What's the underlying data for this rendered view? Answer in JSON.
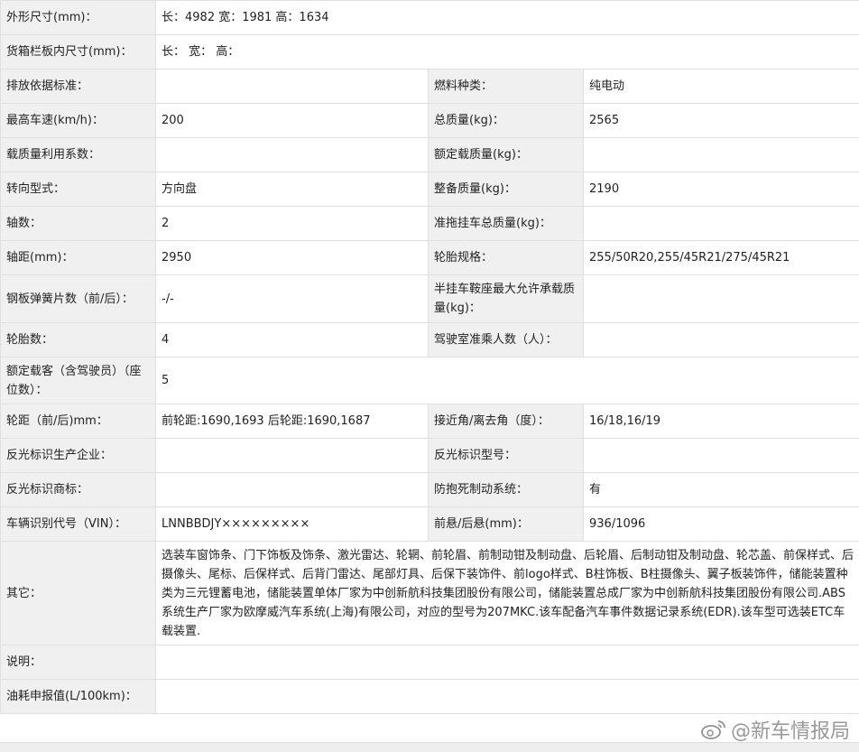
{
  "rows": {
    "dimensions": {
      "label": "外形尺寸(mm)：",
      "value": "长：4982 宽：1981 高：1634"
    },
    "cargo_box": {
      "label": "货箱栏板内尺寸(mm)：",
      "value": "长：  宽：  高："
    },
    "emission": {
      "label": "排放依据标准：",
      "value": "",
      "label2": "燃料种类：",
      "value2": "纯电动"
    },
    "max_speed": {
      "label": "最高车速(km/h)：",
      "value": "200",
      "label2": "总质量(kg)：",
      "value2": "2565"
    },
    "load_coef": {
      "label": "载质量利用系数：",
      "value": "",
      "label2": "额定载质量(kg)：",
      "value2": ""
    },
    "steering": {
      "label": "转向型式：",
      "value": "方向盘",
      "label2": "整备质量(kg)：",
      "value2": "2190"
    },
    "axles": {
      "label": "轴数：",
      "value": "2",
      "label2": "准拖挂车总质量(kg)：",
      "value2": ""
    },
    "wheelbase": {
      "label": "轴距(mm)：",
      "value": "2950",
      "label2": "轮胎规格：",
      "value2": "255/50R20,255/45R21/275/45R21"
    },
    "springs": {
      "label": "钢板弹簧片数（前/后）：",
      "value": "-/-",
      "label2": "半挂车鞍座最大允许承载质量(kg)：",
      "value2": ""
    },
    "tires": {
      "label": "轮胎数：",
      "value": "4",
      "label2": "驾驶室准乘人数（人）：",
      "value2": ""
    },
    "passengers": {
      "label": "额定载客（含驾驶员）（座位数）：",
      "value": "5"
    },
    "track": {
      "label": "轮距（前/后)mm：",
      "value": "前轮距:1690,1693 后轮距:1690,1687",
      "label2": "接近角/离去角（度）：",
      "value2": "16/18,16/19"
    },
    "reflector_maker": {
      "label": "反光标识生产企业：",
      "value": "",
      "label2": "反光标识型号：",
      "value2": ""
    },
    "reflector_brand": {
      "label": "反光标识商标：",
      "value": "",
      "label2": "防抱死制动系统：",
      "value2": "有"
    },
    "vin": {
      "label": "车辆识别代号（VIN）：",
      "value": "LNNBBDJY×××××××××",
      "label2": "前悬/后悬(mm)：",
      "value2": "936/1096"
    },
    "other": {
      "label": "其它：",
      "value": "选装车窗饰条、门下饰板及饰条、激光雷达、轮辋、前轮眉、前制动钳及制动盘、后轮眉、后制动钳及制动盘、轮芯盖、前保样式、后摄像头、尾标、后保样式、后背门雷达、尾部灯具、后保下装饰件、前logo样式、B柱饰板、B柱摄像头、翼子板装饰件，储能装置种类为三元锂蓄电池，储能装置单体厂家为中创新航科技集团股份有限公司，储能装置总成厂家为中创新航科技集团股份有限公司.ABS系统生产厂家为欧摩威汽车系统(上海)有限公司，对应的型号为207MKC.该车配备汽车事件数据记录系统(EDR).该车型可选装ETC车载装置."
    },
    "notes": {
      "label": "说明：",
      "value": ""
    },
    "fuel": {
      "label": "油耗申报值(L/100km)：",
      "value": ""
    }
  },
  "watermark": {
    "text": "@新车情报局",
    "icon": "weibo-logo-icon"
  }
}
